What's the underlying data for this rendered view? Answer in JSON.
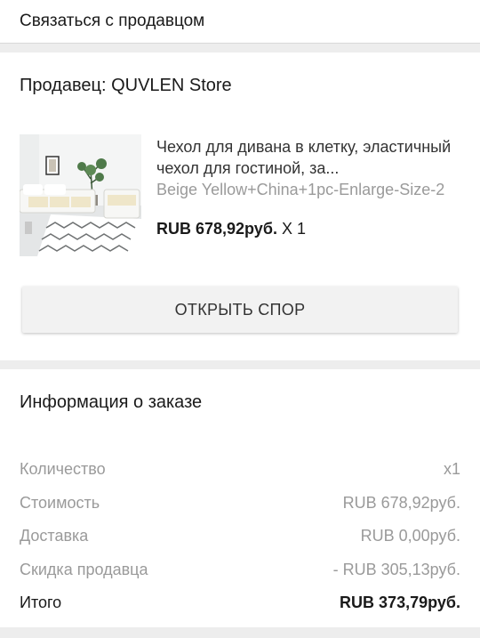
{
  "contact_seller": "Связаться с продавцом",
  "seller": {
    "label": "Продавец: QUVLEN Store"
  },
  "product": {
    "title": "Чехол для дивана в клетку, эластичный чехол для гостиной, за...",
    "variant": "Beige Yellow+China+1pc-Enlarge-Size-2",
    "price": "RUB 678,92руб.",
    "quantity": "X 1"
  },
  "dispute_button": "ОТКРЫТЬ СПОР",
  "order_info": {
    "title": "Информация о заказе",
    "rows": [
      {
        "label": "Количество",
        "value": "x1"
      },
      {
        "label": "Стоимость",
        "value": "RUB 678,92руб."
      },
      {
        "label": "Доставка",
        "value": "RUB 0,00руб."
      },
      {
        "label": "Скидка продавца",
        "value": "- RUB 305,13руб."
      },
      {
        "label": "Итого",
        "value": "RUB 373,79руб."
      }
    ]
  }
}
